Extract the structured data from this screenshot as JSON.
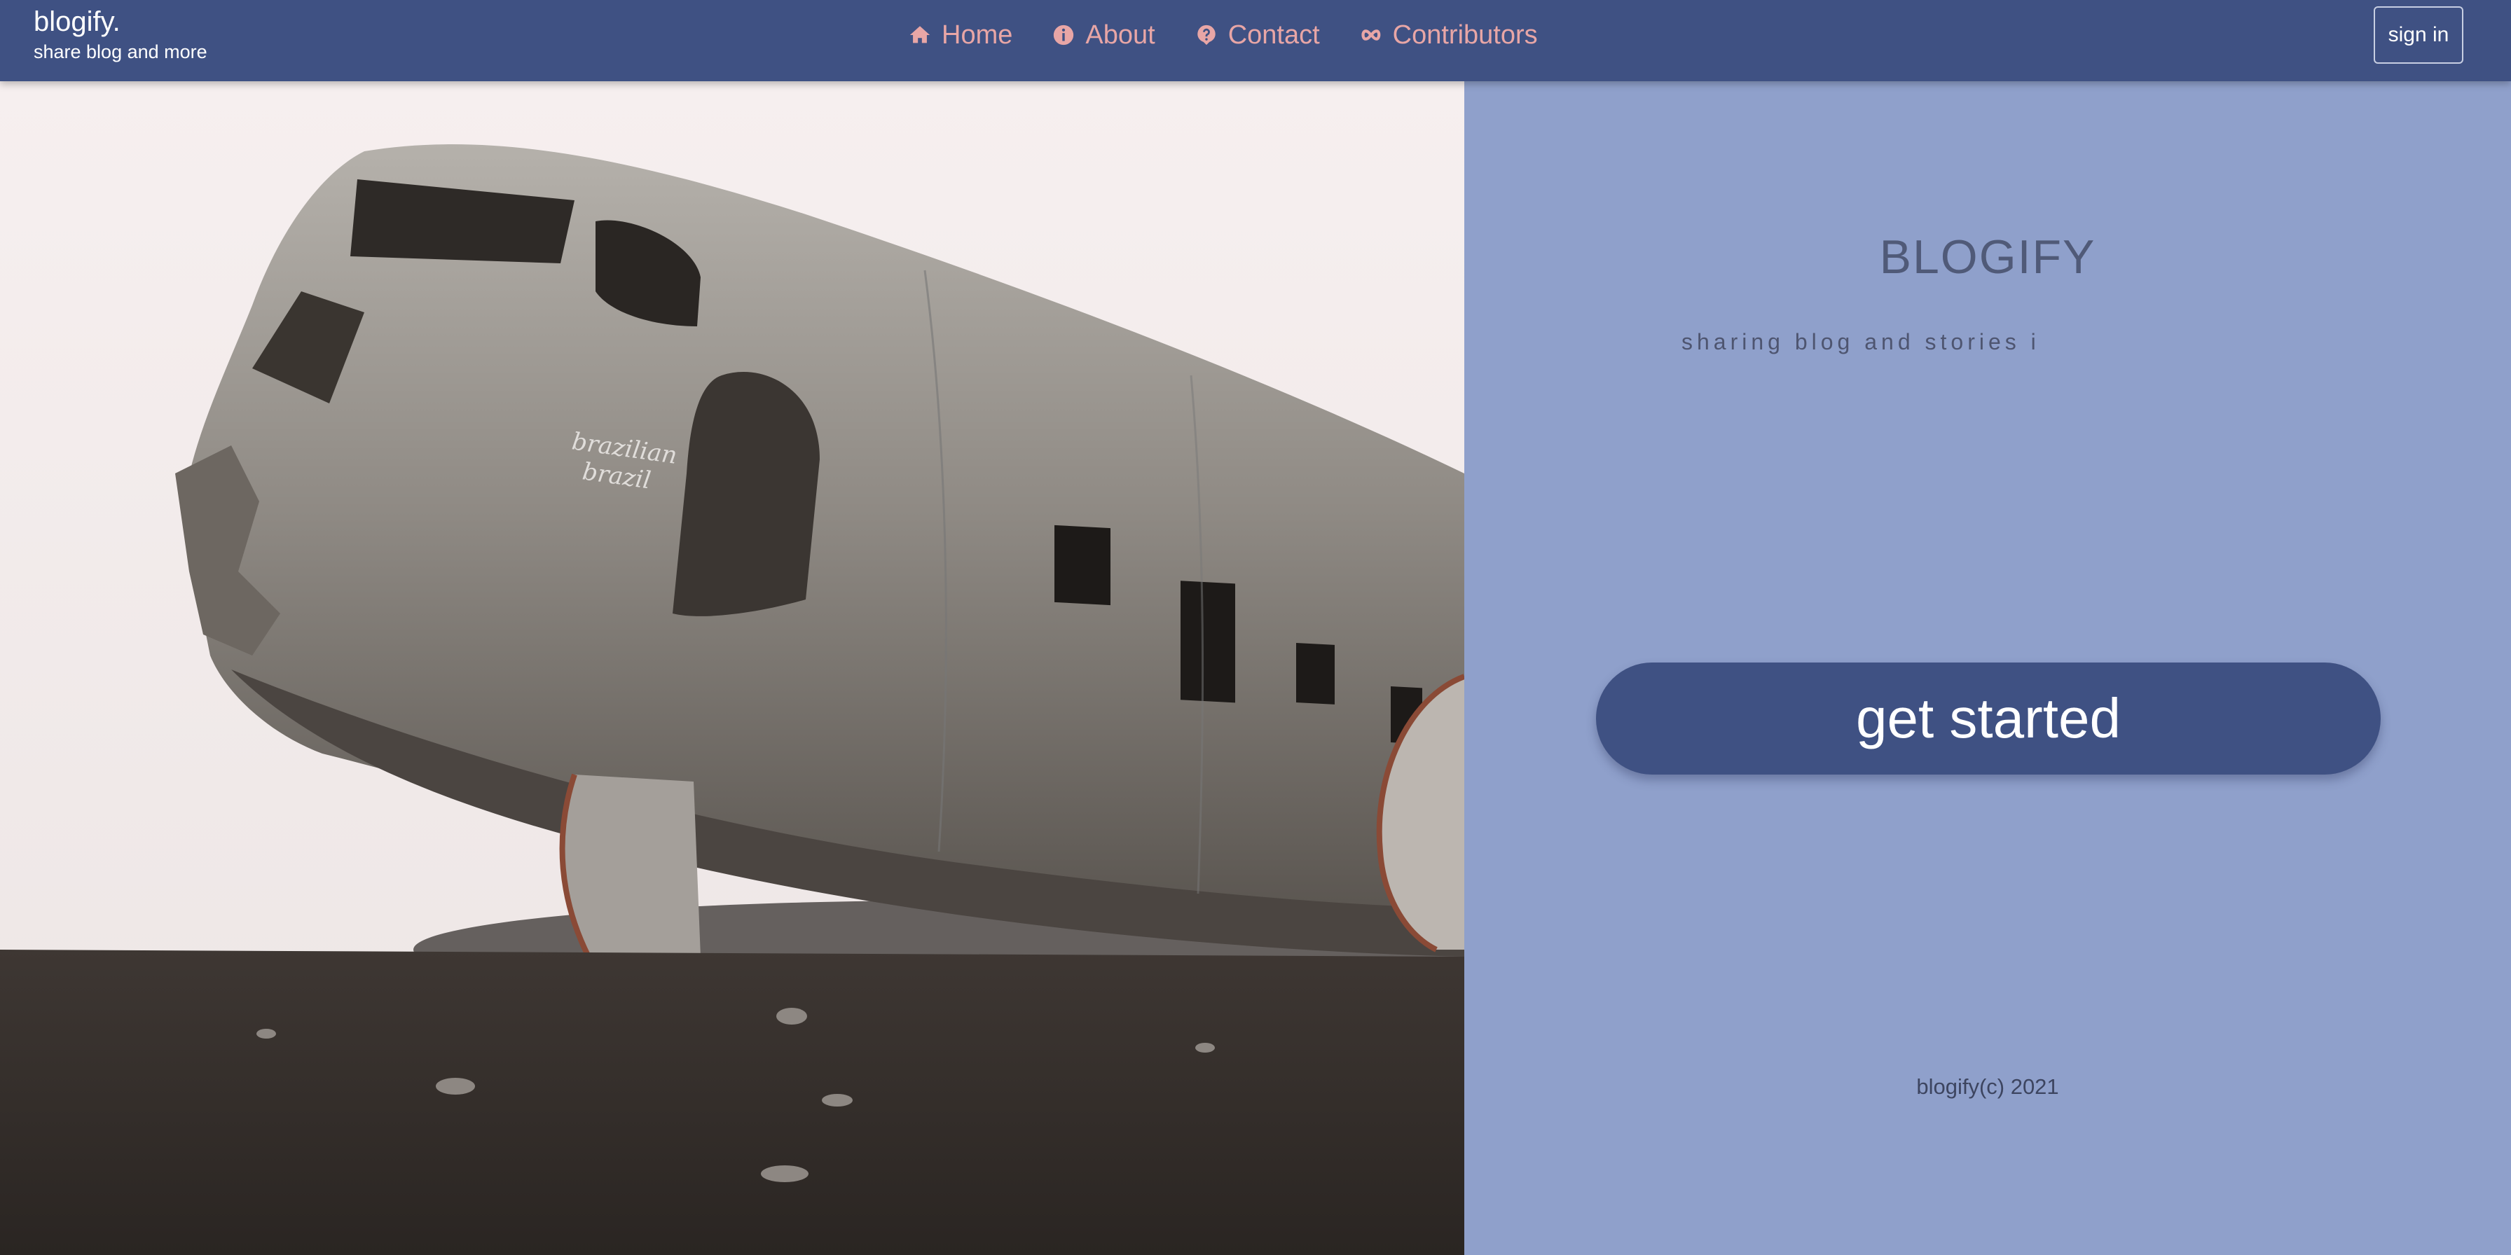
{
  "navbar": {
    "brand_title": "blogify.",
    "brand_subtitle": "share blog and more",
    "links": [
      {
        "label": "Home",
        "icon": "home-icon"
      },
      {
        "label": "About",
        "icon": "info-icon"
      },
      {
        "label": "Contact",
        "icon": "question-icon"
      },
      {
        "label": "Contributors",
        "icon": "infinity-icon"
      }
    ],
    "signin_label": "sign in"
  },
  "hero": {
    "image": "crashed-airplane-photo",
    "plane_graffiti": "brazilian brazil"
  },
  "panel": {
    "title": "BLOGIFY",
    "tagline": "sharing blog and stories i",
    "cta_label": "get started",
    "footer": "blogify(c) 2021"
  },
  "colors": {
    "navbar": "#3f5183",
    "nav_link": "#e8a6a6",
    "panel_bg": "#8fa0cb",
    "button": "#3f5183"
  }
}
